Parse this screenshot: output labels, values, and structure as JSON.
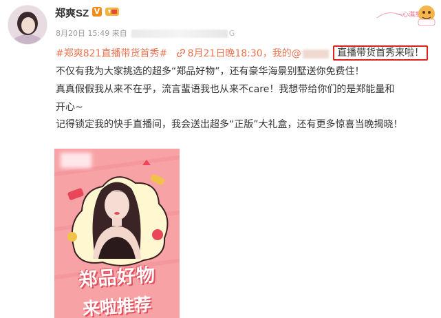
{
  "post": {
    "username": "郑爽SZ",
    "verified_badge": "V",
    "meta_date": "8月20日 15:49 来自",
    "meta_tail": "G",
    "hashtag": "#郑爽821直播带货首秀#",
    "link_text": "8月21日晚18:30，我的@",
    "highlight": "直播带货首秀来啦！",
    "line2": "不仅有我为大家挑选的超多“郑品好物”，还有豪华海景别墅送你免费住！",
    "line3": "真真假假我从来不在乎，流言蜚语我也从来不care！我想带给你们的是郑能量和",
    "line4": "开心~",
    "line5": "记得锁定我的快手直播间，我会送出超多“正版”大礼盒，还有更多惊喜当晚揭晓！"
  },
  "poster": {
    "title_line1": "郑品好物",
    "title_line2": "来啦推荐"
  },
  "sticker": {
    "text": "一心满意"
  },
  "colors": {
    "link_orange": "#eb7350",
    "highlight_red": "#e0201c",
    "poster_pink": "#f7a3a6"
  },
  "icons": {
    "link": "link-icon",
    "verified": "verified-icon",
    "level": "level-badge-icon"
  }
}
